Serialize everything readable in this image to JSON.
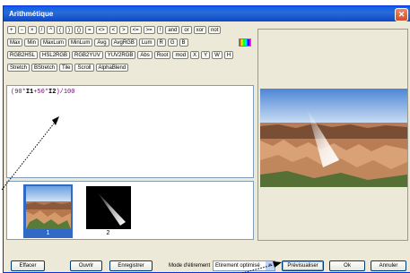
{
  "window": {
    "title": "Arithmétique",
    "close_glyph": "✕"
  },
  "toolbar": {
    "row1": [
      "+",
      "−",
      "×",
      "/",
      "^",
      "(",
      ")",
      "()",
      "=",
      "<>",
      "<",
      ">",
      "<=",
      ">=",
      "!",
      "and",
      "or",
      "xor",
      "not"
    ],
    "row2": [
      "Max",
      "Min",
      "MaxLum",
      "MinLum",
      "Avg",
      "AvgRGB",
      "Lum",
      "R",
      "G",
      "B"
    ],
    "row3": [
      "RGB2HSL",
      "HSL2RGB",
      "RGB2YUV",
      "YUV2RGB",
      "Abs",
      "Root",
      "mod",
      "X",
      "Y",
      "W",
      "H"
    ],
    "row4": [
      "Stretch",
      "BStretch",
      "Tile",
      "Scroll",
      "AlphaBlend"
    ],
    "color_swatch_icon": "palette-icon"
  },
  "editor": {
    "expr_open": "(90*",
    "i1": "I1",
    "expr_mid": "+50*",
    "i2": "I2",
    "expr_close": ")/100"
  },
  "thumbnails": [
    {
      "label": "1",
      "selected": true
    },
    {
      "label": "2",
      "selected": false
    }
  ],
  "bottom": {
    "effacer": "Effacer",
    "ouvrir": "Ouvrir",
    "enregistrer": "Enregistrer",
    "mode_label": "Mode d'étirement",
    "mode_value": "Etirement optimisé",
    "previsualiser": "Prévisualiser",
    "ok": "Ok",
    "annuler": "Annuler"
  },
  "colors": {
    "title_bar": "#0d48c6",
    "selection": "#316ac5",
    "expression": "#800080"
  }
}
